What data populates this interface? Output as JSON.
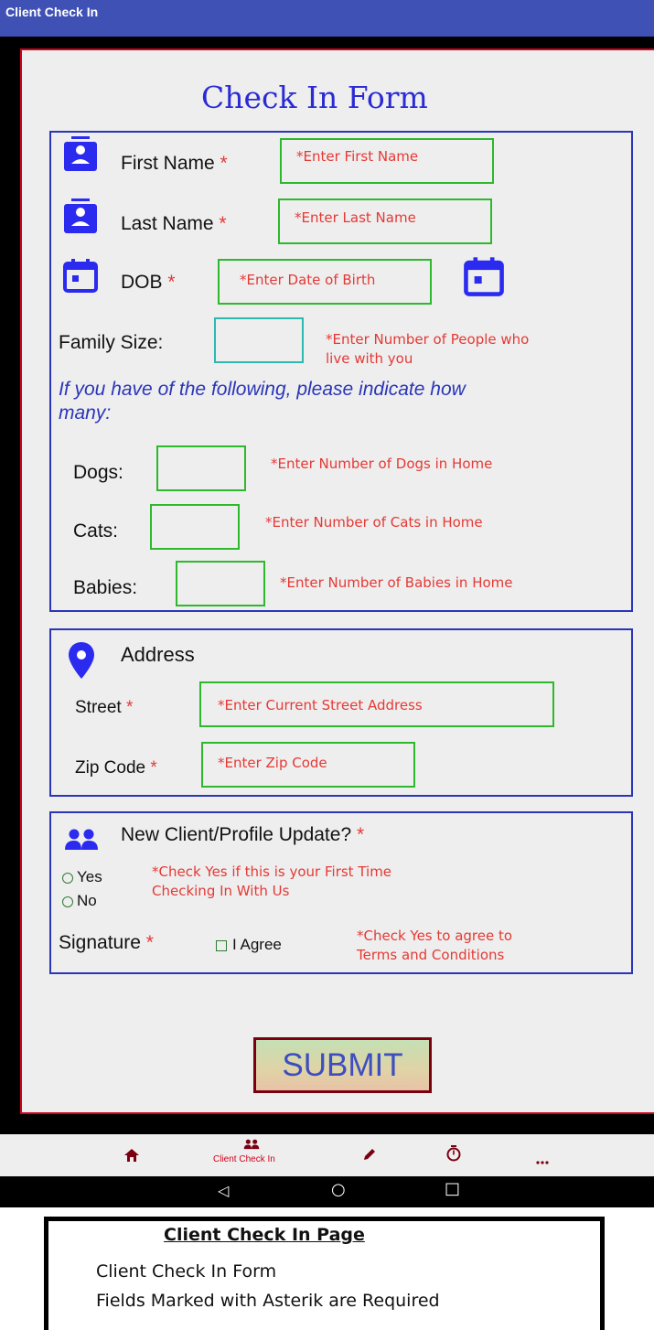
{
  "app_bar": {
    "title": "Client Check In"
  },
  "form": {
    "title": "Check In Form",
    "first_name": {
      "label": "First Name",
      "required": "*",
      "placeholder": "*Enter First Name"
    },
    "last_name": {
      "label": "Last Name",
      "required": "*",
      "placeholder": "*Enter Last Name"
    },
    "dob": {
      "label": "DOB",
      "required": "*",
      "placeholder": "*Enter Date of Birth"
    },
    "family_size": {
      "label": "Family Size:",
      "hint_line1": "*Enter Number of People who",
      "hint_line2": "live with you"
    },
    "pets_prompt_line1": "If you have of the following, please indicate how",
    "pets_prompt_line2": "many:",
    "dogs": {
      "label": "Dogs:",
      "hint": "*Enter Number of Dogs in Home"
    },
    "cats": {
      "label": "Cats:",
      "hint": "*Enter Number of Cats in Home"
    },
    "babies": {
      "label": "Babies:",
      "hint": "*Enter Number of Babies in Home"
    },
    "address": {
      "heading": "Address",
      "street": {
        "label": "Street",
        "required": "*",
        "placeholder": "*Enter Current Street Address"
      },
      "zip": {
        "label": "Zip Code",
        "required": "*",
        "placeholder": "*Enter Zip Code"
      }
    },
    "client_type": {
      "question": "New Client/Profile Update?",
      "required": "*",
      "options": [
        "Yes",
        "No"
      ],
      "hint_line1": "*Check Yes if this is your First Time",
      "hint_line2": "Checking In With Us"
    },
    "signature": {
      "label": "Signature",
      "required": "*",
      "checkbox_label": "I Agree",
      "hint_line1": "*Check Yes to agree to",
      "hint_line2": "Terms and Conditions"
    },
    "submit_label": "SUBMIT"
  },
  "bottom_nav": {
    "items": [
      {
        "icon": "home-icon"
      },
      {
        "icon": "people-icon",
        "label": "Client Check In",
        "active": true
      },
      {
        "icon": "pencil-icon"
      },
      {
        "icon": "timer-icon"
      },
      {
        "icon": "more-icon"
      }
    ]
  },
  "system_nav": {
    "back": "◁",
    "home": "○",
    "recents": "□"
  },
  "caption": {
    "title": "Client Check In Page",
    "line1": "Client Check In Form",
    "line2": "Fields Marked with Asterik are Required"
  },
  "colors": {
    "app_bar": "#3f51b5",
    "form_border": "#d0021b",
    "section_border": "#2a35b8",
    "input_border": "#2db82d",
    "hint_text": "#e53935",
    "icon_blue": "#2b2bf0"
  }
}
